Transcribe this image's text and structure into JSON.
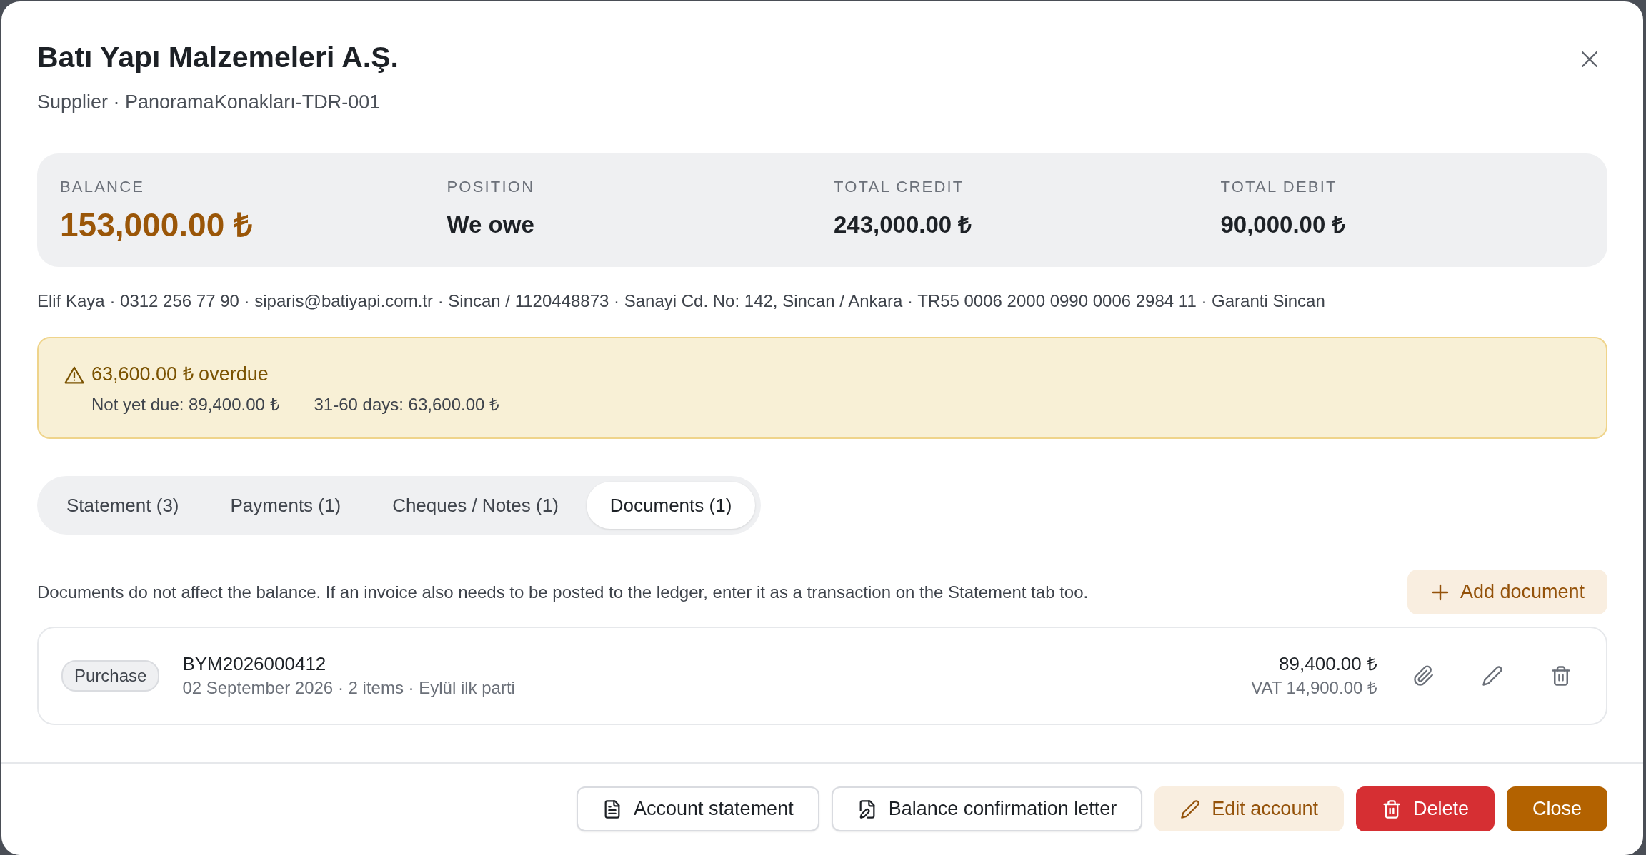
{
  "dialog": {
    "title": "Batı Yapı Malzemeleri A.Ş.",
    "subtitle": "Supplier · PanoramaKonakları-TDR-001"
  },
  "summary": [
    {
      "label": "BALANCE",
      "value": "153,000.00 ₺",
      "highlighted": true
    },
    {
      "label": "POSITION",
      "value": "We owe",
      "highlighted": false
    },
    {
      "label": "TOTAL CREDIT",
      "value": "243,000.00 ₺",
      "highlighted": false
    },
    {
      "label": "TOTAL DEBIT",
      "value": "90,000.00 ₺",
      "highlighted": false
    }
  ],
  "contact_line": "Elif Kaya · 0312 256 77 90 · siparis@batiyapi.com.tr · Sincan / 1120448873 · Sanayi Cd. No: 142, Sincan / Ankara · TR55 0006 2000 0990 0006 2984 11 · Garanti Sincan",
  "alert": {
    "title": "63,600.00 ₺ overdue",
    "details": [
      "Not yet due: 89,400.00 ₺",
      "31-60 days: 63,600.00 ₺"
    ]
  },
  "tabs": [
    {
      "label": "Statement (3)",
      "selected": false
    },
    {
      "label": "Payments (1)",
      "selected": false
    },
    {
      "label": "Cheques / Notes (1)",
      "selected": false
    },
    {
      "label": "Documents (1)",
      "selected": true
    }
  ],
  "documents": {
    "note": "Documents do not affect the balance. If an invoice also needs to be posted to the ledger, enter it as a transaction on the Statement tab too.",
    "add_button": "Add document",
    "items": [
      {
        "tag": "Purchase",
        "number": "BYM2026000412",
        "meta": "02 September 2026 · 2 items · Eylül ilk parti",
        "amount": "89,400.00 ₺",
        "vat": "VAT 14,900.00 ₺"
      }
    ]
  },
  "footer_buttons": [
    {
      "label": "Account statement",
      "kind": "statement"
    },
    {
      "label": "Balance confirmation letter",
      "kind": "letter"
    },
    {
      "label": "Edit account",
      "kind": "edit"
    },
    {
      "label": "Delete",
      "kind": "delete"
    },
    {
      "label": "Close",
      "kind": "close"
    }
  ]
}
